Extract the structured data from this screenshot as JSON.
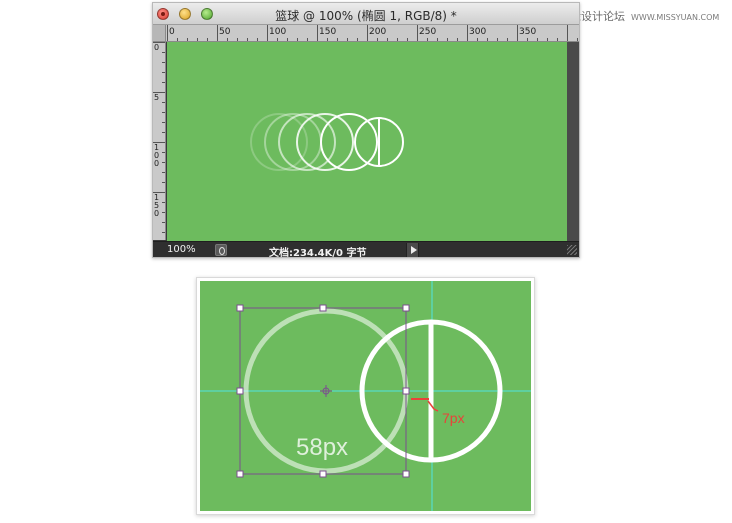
{
  "watermark": {
    "text": "思缘设计论坛",
    "domain": "WWW.MISSYUAN.COM"
  },
  "window": {
    "title": "篮球 @ 100% (椭圆 1, RGB/8) *",
    "ruler_h_labels": [
      "0",
      "50",
      "100",
      "150",
      "200",
      "250",
      "300",
      "350"
    ],
    "ruler_v_labels": [
      "0",
      "5",
      "1 0 0",
      "1 5 0"
    ],
    "canvas_color": "#6dbb5e"
  },
  "status": {
    "zoom": "100%",
    "doc_info": "文档:234.4K/0 字节"
  },
  "detail": {
    "size_label": "58px",
    "gap_label": "7px",
    "guide_color": "#4ee6e0",
    "selection_color": "#7b4f8f",
    "measure_color": "#e8433a"
  }
}
